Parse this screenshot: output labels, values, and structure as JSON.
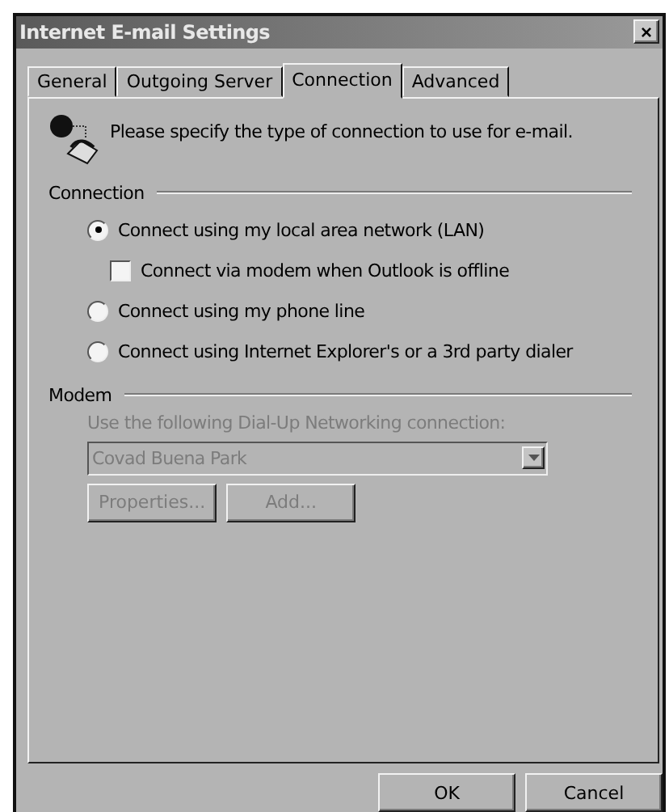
{
  "window": {
    "title": "Internet E-mail Settings",
    "close": "×"
  },
  "tabs": [
    {
      "label": "General",
      "selected": false
    },
    {
      "label": "Outgoing Server",
      "selected": false
    },
    {
      "label": "Connection",
      "selected": true
    },
    {
      "label": "Advanced",
      "selected": false
    }
  ],
  "intro": "Please specify the type of connection to use for e-mail.",
  "connection": {
    "heading": "Connection",
    "options": [
      {
        "kind": "radio",
        "label": "Connect using my local area network (LAN)",
        "selected": true,
        "indented": false
      },
      {
        "kind": "checkbox",
        "label": "Connect via modem when Outlook is offline",
        "checked": false,
        "indented": true
      },
      {
        "kind": "radio",
        "label": "Connect using my phone line",
        "selected": false,
        "indented": false
      },
      {
        "kind": "radio",
        "label": "Connect using Internet Explorer's or a 3rd party dialer",
        "selected": false,
        "indented": false
      }
    ]
  },
  "modem": {
    "heading": "Modem",
    "disabled": true,
    "prompt": "Use the following Dial-Up Networking connection:",
    "dropdown": {
      "value": "Covad Buena Park"
    },
    "buttons": [
      "Properties...",
      "Add..."
    ]
  },
  "buttons": [
    "OK",
    "Cancel"
  ]
}
